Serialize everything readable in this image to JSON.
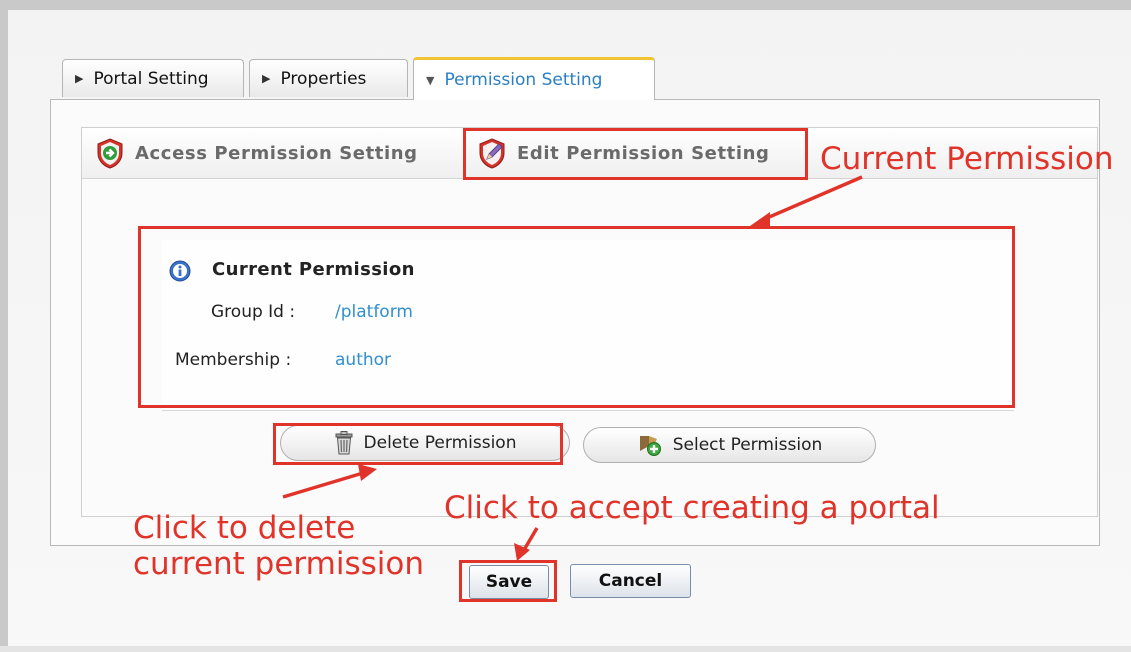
{
  "tabs": [
    {
      "label": "Portal Setting",
      "active": false
    },
    {
      "label": "Properties",
      "active": false
    },
    {
      "label": "Permission Setting",
      "active": true
    }
  ],
  "sub_tabs": {
    "access": "Access Permission Setting",
    "edit": "Edit Permission Setting"
  },
  "permission": {
    "title": "Current Permission",
    "group_label": "Group Id :",
    "group_value": "/platform",
    "membership_label": "Membership :",
    "membership_value": "author"
  },
  "buttons": {
    "delete": "Delete Permission",
    "select": "Select Permission",
    "save": "Save",
    "cancel": "Cancel"
  },
  "annotations": {
    "current_permission": "Current Permission",
    "delete_line1": "Click to delete",
    "delete_line2": "current permission",
    "accept": "Click to accept creating a portal"
  },
  "colors": {
    "annotation_red": "#e0342a",
    "link_blue": "#2f8fd0",
    "active_tab_accent": "#f0c432"
  },
  "icons": {
    "tab_collapsed": "triangle-right-icon",
    "tab_expanded": "triangle-down-icon",
    "access": "shield-arrow-icon",
    "edit": "shield-pencil-icon",
    "info": "info-icon",
    "delete": "trash-icon",
    "select": "add-permission-icon"
  }
}
